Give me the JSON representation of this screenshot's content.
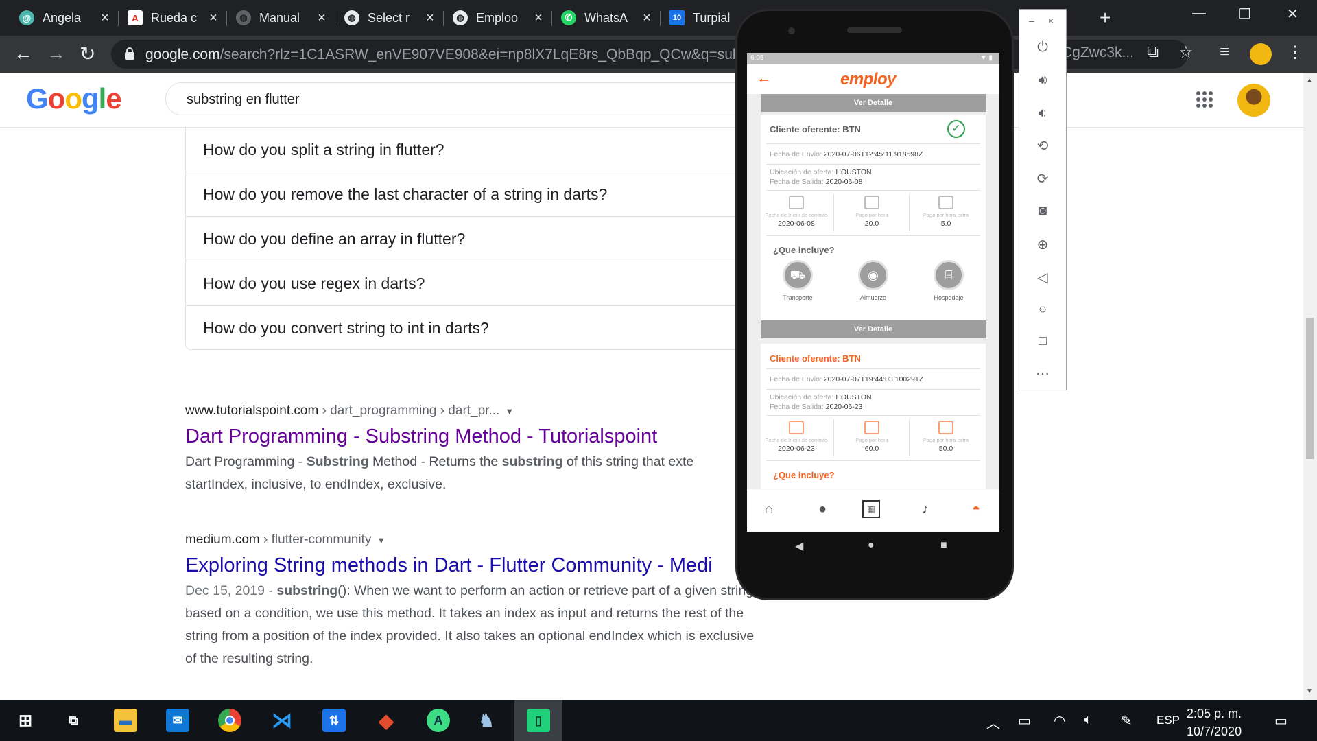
{
  "browser": {
    "tabs": [
      {
        "title": "Angela",
        "icon": "at-icon",
        "color": "#3c4043"
      },
      {
        "title": "Rueda c",
        "icon": "adobe-icon",
        "color": "#e8201a"
      },
      {
        "title": "Manual",
        "icon": "globe-icon",
        "color": "#5f6368"
      },
      {
        "title": "Select r",
        "icon": "globe-icon",
        "color": "#5f6368"
      },
      {
        "title": "Emploo",
        "icon": "globe-icon",
        "color": "#5f6368"
      },
      {
        "title": "WhatsA",
        "icon": "whatsapp-icon",
        "color": "#25d366"
      },
      {
        "title": "Turpial",
        "icon": "calendar-icon",
        "color": "#1a73e8"
      }
    ],
    "calendar_day": "10",
    "url_host": "google.com",
    "url_path": "/search?rlz=1C1ASRW_enVE907VE908&ei=np8lX7LqE8rs_QbBqp_QCw&q=subst",
    "url_tail": "CgZwc3k..."
  },
  "google": {
    "logo": "Google",
    "query": "substring en flutter"
  },
  "paa": [
    "How do you split a string in flutter?",
    "How do you remove the last character of a string in darts?",
    "How do you define an array in flutter?",
    "How do you use regex in darts?",
    "How do you convert string to int in darts?"
  ],
  "results": [
    {
      "site": "www.tutorialspoint.com",
      "path": " › dart_programming › dart_pr...",
      "title": "Dart Programming - Substring Method - Tutorialspoint",
      "title_color": "#660099",
      "snippet_html": "Dart Programming - <b>Substring</b> Method - Returns the <b>substring</b> of this string that exte<br>startIndex, inclusive, to endIndex, exclusive."
    },
    {
      "site": "medium.com",
      "path": " › flutter-community",
      "title": "Exploring String methods in Dart - Flutter Community - Medi",
      "title_color": "#1a0dab",
      "date": "Dec 15, 2019",
      "snippet_html": " - <b>substring</b>(): When we want to perform an action or retrieve part of a given string<br>based on a condition, we use this method. It takes an index as input and returns the rest of the<br>string from a position of the index provided. It also takes an optional endIndex which is exclusive<br>of the resulting string."
    }
  ],
  "phone": {
    "time": "6:05",
    "brand": "employ",
    "accent": "#f26322",
    "ver_detalle": "Ver Detalle",
    "cards": [
      {
        "client": "Cliente oferente: BTN",
        "fecha_envio_label": "Fecha de Envio:",
        "fecha_envio": "2020-07-06T12:45:11.918598Z",
        "ubicacion_label": "Ubicación de oferta:",
        "ubicacion": "HOUSTON",
        "salida_label": "Fecha de Salida:",
        "salida": "2020-06-08",
        "stats": [
          {
            "label": "Fecha de Inicio de contrato",
            "value": "2020-06-08"
          },
          {
            "label": "Pago por hora",
            "value": "20.0"
          },
          {
            "label": "Pago por hora extra",
            "value": "5.0"
          }
        ],
        "que_incluye": "¿Que incluye?",
        "includes": [
          "Transporte",
          "Almuerzo",
          "Hospedaje"
        ]
      },
      {
        "client": "Cliente oferente: BTN",
        "fecha_envio_label": "Fecha de Envio:",
        "fecha_envio": "2020-07-07T19:44:03.100291Z",
        "ubicacion_label": "Ubicación de oferta:",
        "ubicacion": "HOUSTON",
        "salida_label": "Fecha de Salida:",
        "salida": "2020-06-23",
        "stats": [
          {
            "label": "Fecha de Inicio de contrato",
            "value": "2020-06-23"
          },
          {
            "label": "Pago por hora",
            "value": "60.0"
          },
          {
            "label": "Pago por hora extra",
            "value": "50.0"
          }
        ],
        "que_incluye": "¿Que incluye?"
      }
    ]
  },
  "taskbar": {
    "language": "ESP",
    "time": "2:05 p. m.",
    "date": "10/7/2020"
  }
}
